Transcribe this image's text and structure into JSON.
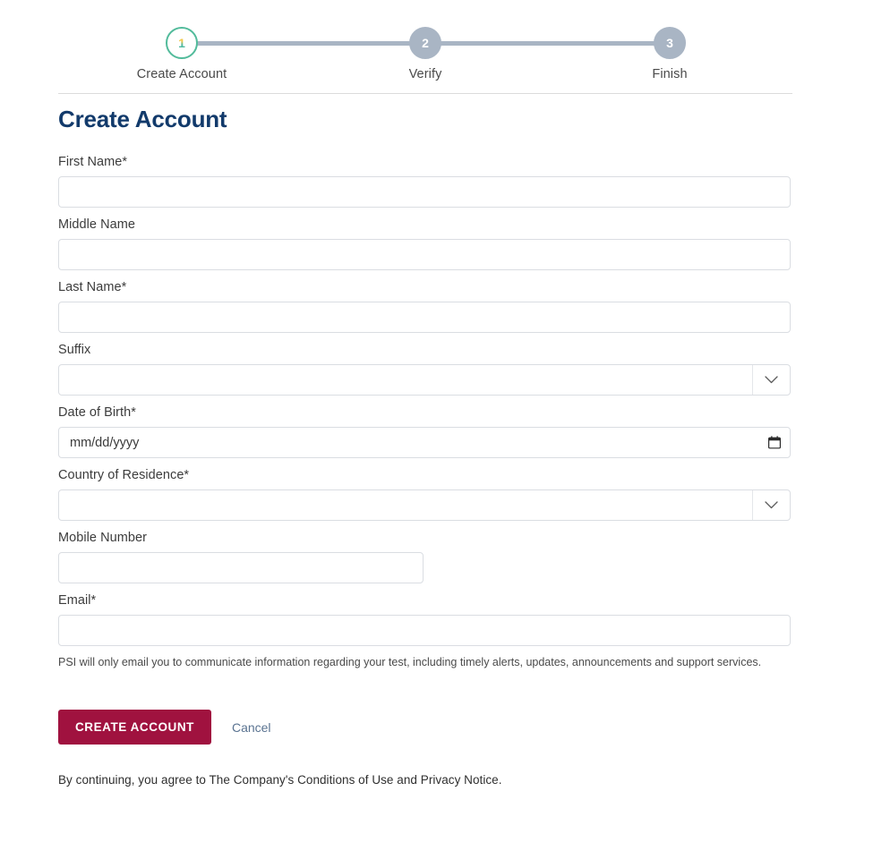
{
  "stepper": {
    "steps": [
      {
        "number": "1",
        "label": "Create Account",
        "state": "active"
      },
      {
        "number": "2",
        "label": "Verify",
        "state": "inactive"
      },
      {
        "number": "3",
        "label": "Finish",
        "state": "inactive"
      }
    ]
  },
  "page": {
    "title": "Create Account"
  },
  "form": {
    "fields": [
      {
        "label": "First Name*",
        "type": "text",
        "value": "",
        "placeholder": ""
      },
      {
        "label": "Middle Name",
        "type": "text",
        "value": "",
        "placeholder": ""
      },
      {
        "label": "Last Name*",
        "type": "text",
        "value": "",
        "placeholder": ""
      },
      {
        "label": "Suffix",
        "type": "select",
        "value": "",
        "placeholder": ""
      },
      {
        "label": "Date of Birth*",
        "type": "date",
        "value": "",
        "placeholder": "mm/dd/yyyy"
      },
      {
        "label": "Country of Residence*",
        "type": "select",
        "value": "",
        "placeholder": ""
      },
      {
        "label": "Mobile Number",
        "type": "tel",
        "value": "",
        "placeholder": ""
      },
      {
        "label": "Email*",
        "type": "email",
        "value": "",
        "placeholder": ""
      }
    ],
    "email_helper": "PSI will only email you to communicate information regarding your test, including timely alerts, updates, announcements and support services."
  },
  "actions": {
    "submit_label": "CREATE ACCOUNT",
    "cancel_label": "Cancel"
  },
  "legal": {
    "text": "By continuing, you agree to The Company's Conditions of Use and Privacy Notice."
  },
  "icons": {
    "chevron_down": "chevron-down-icon",
    "calendar": "calendar-icon"
  },
  "colors": {
    "accent_primary": "#a0123f",
    "title": "#123a6b",
    "step_active": "#52bb9b",
    "step_inactive": "#a9b5c4",
    "link": "#5a7391",
    "border": "#dadde2"
  }
}
